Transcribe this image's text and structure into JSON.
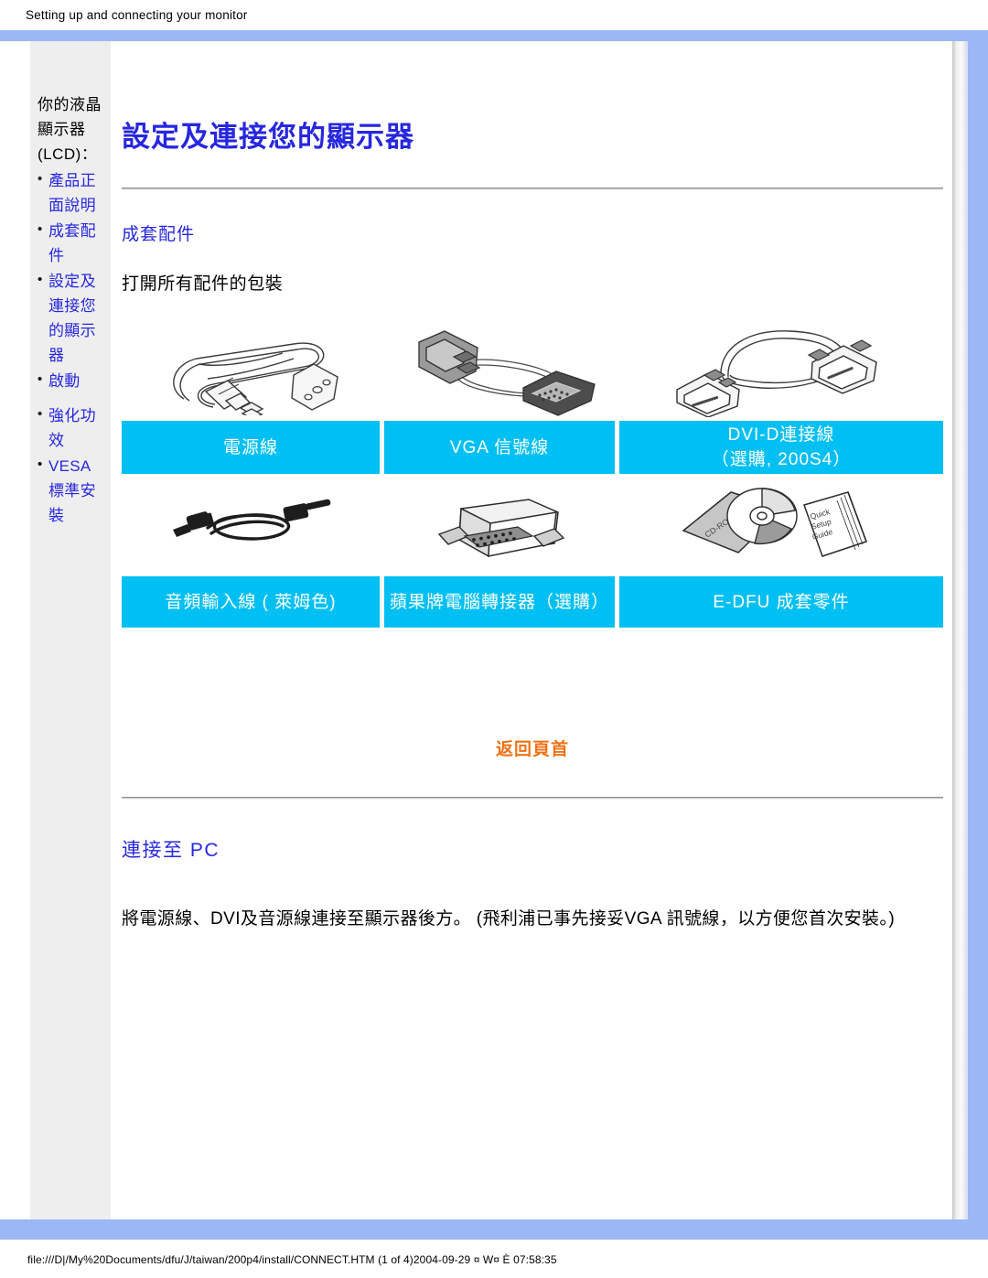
{
  "print_header": {
    "text": "Setting up and connecting your monitor"
  },
  "print_footer": {
    "text": "file:///D|/My%20Documents/dfu/J/taiwan/200p4/install/CONNECT.HTM (1 of 4)2004-09-29 ¤ W¤ È 07:58:35"
  },
  "sidebar": {
    "title": "你的液晶顯示器 (LCD)：",
    "items": [
      {
        "label": "產品正面說明"
      },
      {
        "label": "成套配件"
      },
      {
        "label": "設定及連接您的顯示器"
      },
      {
        "label": "啟動"
      },
      {
        "label": "強化功效"
      },
      {
        "label": "VESA 標準安裝"
      }
    ]
  },
  "main": {
    "page_title": "設定及連接您的顯示器",
    "accessories_heading": "成套配件",
    "accessories_intro": "打開所有配件的包裝",
    "accessories": [
      {
        "row": 1,
        "cells": [
          {
            "icon": "power-cord-icon",
            "label": "電源線"
          },
          {
            "icon": "vga-signal-cable-icon",
            "label": "VGA 信號線"
          },
          {
            "icon": "dvi-d-cable-icon",
            "label": "DVI-D連接線\n（選購, 200S4）",
            "label_line1": "DVI-D連接線",
            "label_line2": "（選購, 200S4）"
          }
        ]
      },
      {
        "row": 2,
        "cells": [
          {
            "icon": "audio-input-cable-icon",
            "label": "音頻輸入線 ( 萊姆色)"
          },
          {
            "icon": "mac-adapter-icon",
            "label": "蘋果牌電腦轉接器（選購）"
          },
          {
            "icon": "cdrom-quick-setup-guide-icon",
            "label": "E-DFU 成套零件"
          }
        ]
      }
    ],
    "back_to_top": "返回頁首",
    "connect_heading": "連接至 PC",
    "connect_text": "將電源線、DVI及音源線連接至顯示器後方。 (飛利浦已事先接妥VGA 訊號線，以方便您首次安裝。)",
    "cdrom_disc_label": "CD-ROM",
    "guide_label": "Quick Setup Guide"
  },
  "colors": {
    "page_border_blue": "#9bb7f5",
    "accent_cyan": "#00bff3",
    "link_blue": "#2727e0",
    "back_to_top_orange": "#ef7215",
    "sidebar_bg": "#eeeeee"
  }
}
